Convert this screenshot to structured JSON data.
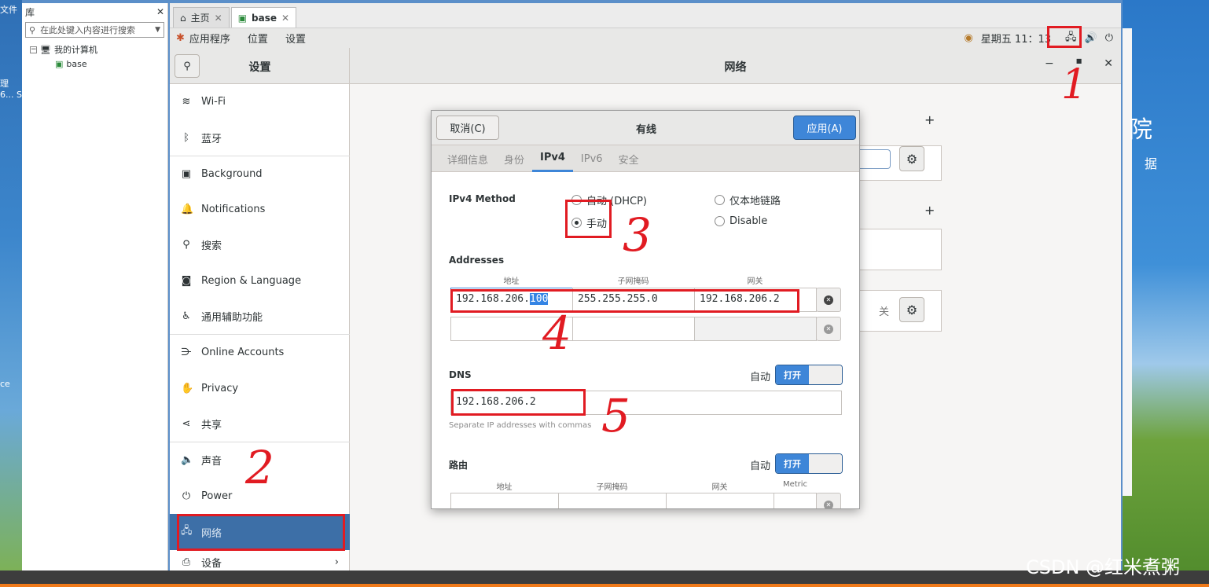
{
  "host": {
    "left_menu": "文件",
    "left_fragments": [
      "理",
      "6... S",
      "ce"
    ],
    "right_big": "院",
    "right_small": "据",
    "watermark": "CSDN @红米煮粥"
  },
  "library": {
    "title": "库",
    "search_placeholder": "在此处键入内容进行搜索",
    "tree": [
      {
        "label": "我的计算机"
      },
      {
        "label": "base"
      }
    ]
  },
  "vm_tabs": [
    {
      "label": "主页"
    },
    {
      "label": "base"
    }
  ],
  "topbar": {
    "applications": "应用程序",
    "places": "位置",
    "settings": "设置",
    "clock": "星期五 11：13"
  },
  "settings": {
    "sidebar_title": "设置",
    "main_title": "网络",
    "items": [
      {
        "label": "Wi-Fi",
        "icon": "wifi-icon"
      },
      {
        "label": "蓝牙",
        "icon": "bluetooth-icon"
      },
      {
        "label": "Background",
        "icon": "background-icon"
      },
      {
        "label": "Notifications",
        "icon": "bell-icon"
      },
      {
        "label": "搜索",
        "icon": "search-icon"
      },
      {
        "label": "Region & Language",
        "icon": "camera-icon"
      },
      {
        "label": "通用辅助功能",
        "icon": "accessibility-icon"
      },
      {
        "label": "Online Accounts",
        "icon": "online-accounts-icon"
      },
      {
        "label": "Privacy",
        "icon": "hand-icon"
      },
      {
        "label": "共享",
        "icon": "share-icon"
      },
      {
        "label": "声音",
        "icon": "speaker-icon"
      },
      {
        "label": "Power",
        "icon": "power-plug-icon"
      },
      {
        "label": "网络",
        "icon": "network-icon"
      },
      {
        "label": "设备",
        "icon": "printer-icon"
      }
    ],
    "background_card": {
      "off_label": "关"
    }
  },
  "dialog": {
    "cancel": "取消(C)",
    "title": "有线",
    "apply": "应用(A)",
    "tabs": [
      "详细信息",
      "身份",
      "IPv4",
      "IPv6",
      "安全"
    ],
    "ipv4_method_label": "IPv4 Method",
    "methods": {
      "auto_dhcp": "自动 (DHCP)",
      "link_local": "仅本地链路",
      "manual": "手动",
      "disable": "Disable"
    },
    "addresses_label": "Addresses",
    "address_cols": {
      "address": "地址",
      "netmask": "子网掩码",
      "gateway": "网关"
    },
    "address_row": {
      "address_prefix": "192.168.206.",
      "address_selected": "100",
      "netmask": "255.255.255.0",
      "gateway": "192.168.206.2"
    },
    "dns_label": "DNS",
    "dns_auto_label": "自动",
    "dns_toggle": "打开",
    "dns_value": "192.168.206.2",
    "dns_hint": "Separate IP addresses with commas",
    "routes_label": "路由",
    "routes_auto_label": "自动",
    "routes_toggle": "打开",
    "route_cols": {
      "address": "地址",
      "netmask": "子网掩码",
      "gateway": "网关",
      "metric": "Metric"
    }
  },
  "annotations": [
    "1",
    "2",
    "3",
    "4",
    "5"
  ]
}
